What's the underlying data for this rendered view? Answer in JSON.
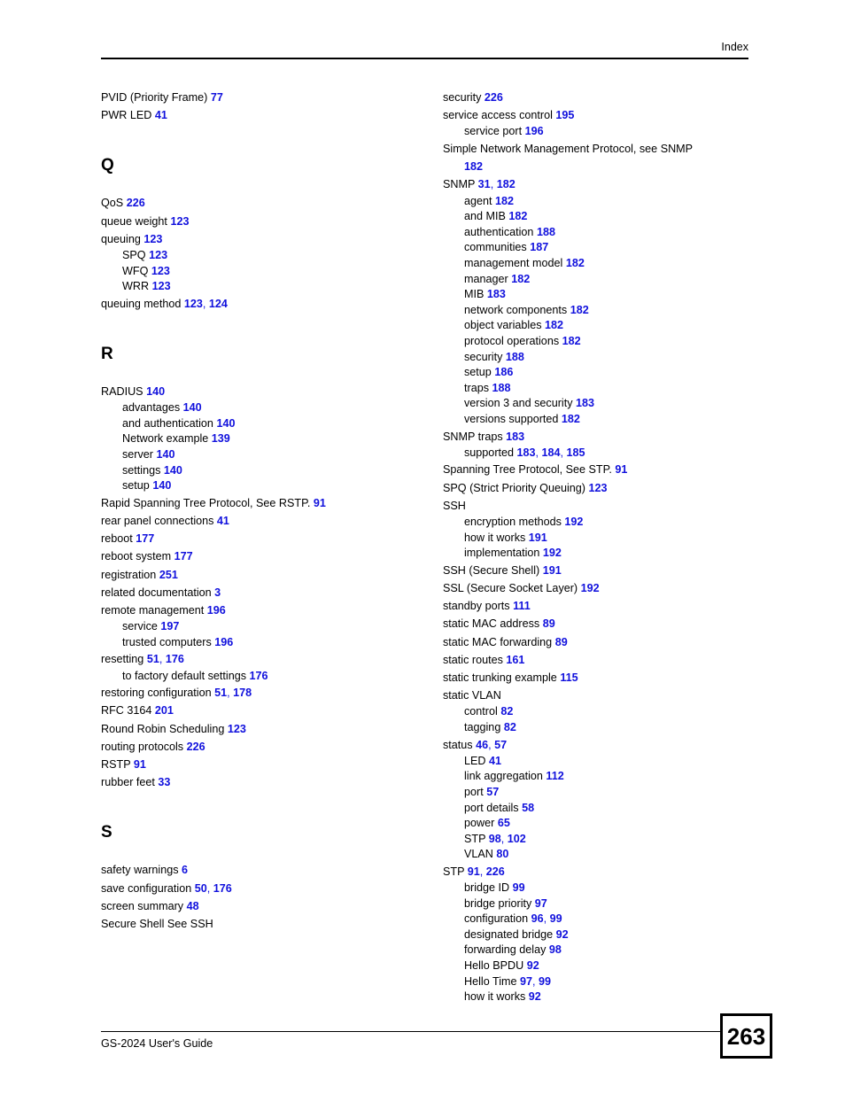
{
  "header": {
    "label": "Index"
  },
  "footer": {
    "guide_title": "GS-2024 User's Guide",
    "page_number": "263"
  },
  "colors": {
    "page_reference": "#1111dd",
    "text": "#000000",
    "background": "#ffffff"
  },
  "columns": [
    {
      "name": "left",
      "blocks": [
        {
          "type": "entries",
          "entries": [
            {
              "level": 0,
              "text": "PVID (Priority Frame)",
              "pages": [
                "77"
              ]
            },
            {
              "level": 0,
              "text": "PWR LED",
              "pages": [
                "41"
              ]
            }
          ]
        },
        {
          "type": "letter",
          "letter": "Q"
        },
        {
          "type": "entries",
          "entries": [
            {
              "level": 0,
              "text": "QoS",
              "pages": [
                "226"
              ]
            },
            {
              "level": 0,
              "text": "queue weight",
              "pages": [
                "123"
              ]
            },
            {
              "level": 0,
              "text": "queuing",
              "pages": [
                "123"
              ]
            },
            {
              "level": 1,
              "text": "SPQ",
              "pages": [
                "123"
              ]
            },
            {
              "level": 1,
              "text": "WFQ",
              "pages": [
                "123"
              ]
            },
            {
              "level": 1,
              "text": "WRR",
              "pages": [
                "123"
              ]
            },
            {
              "level": 0,
              "text": "queuing method",
              "pages": [
                "123",
                "124"
              ]
            }
          ]
        },
        {
          "type": "letter",
          "letter": "R"
        },
        {
          "type": "entries",
          "entries": [
            {
              "level": 0,
              "text": "RADIUS",
              "pages": [
                "140"
              ]
            },
            {
              "level": 1,
              "text": "advantages",
              "pages": [
                "140"
              ]
            },
            {
              "level": 1,
              "text": "and authentication",
              "pages": [
                "140"
              ]
            },
            {
              "level": 1,
              "text": "Network example",
              "pages": [
                "139"
              ]
            },
            {
              "level": 1,
              "text": "server",
              "pages": [
                "140"
              ]
            },
            {
              "level": 1,
              "text": "settings",
              "pages": [
                "140"
              ]
            },
            {
              "level": 1,
              "text": "setup",
              "pages": [
                "140"
              ]
            },
            {
              "level": 0,
              "text": "Rapid Spanning Tree Protocol, See RSTP.",
              "pages": [
                "91"
              ]
            },
            {
              "level": 0,
              "text": "rear panel connections",
              "pages": [
                "41"
              ]
            },
            {
              "level": 0,
              "text": "reboot",
              "pages": [
                "177"
              ]
            },
            {
              "level": 0,
              "text": "reboot system",
              "pages": [
                "177"
              ]
            },
            {
              "level": 0,
              "text": "registration",
              "pages": [
                "251"
              ]
            },
            {
              "level": 0,
              "text": "related documentation",
              "pages": [
                "3"
              ]
            },
            {
              "level": 0,
              "text": "remote management",
              "pages": [
                "196"
              ]
            },
            {
              "level": 1,
              "text": "service",
              "pages": [
                "197"
              ]
            },
            {
              "level": 1,
              "text": "trusted computers",
              "pages": [
                "196"
              ]
            },
            {
              "level": 0,
              "text": "resetting",
              "pages": [
                "51",
                "176"
              ]
            },
            {
              "level": 1,
              "text": "to factory default settings",
              "pages": [
                "176"
              ]
            },
            {
              "level": 0,
              "text": "restoring configuration",
              "pages": [
                "51",
                "178"
              ]
            },
            {
              "level": 0,
              "text": "RFC 3164",
              "pages": [
                "201"
              ]
            },
            {
              "level": 0,
              "text": "Round Robin Scheduling",
              "pages": [
                "123"
              ]
            },
            {
              "level": 0,
              "text": "routing protocols",
              "pages": [
                "226"
              ]
            },
            {
              "level": 0,
              "text": "RSTP",
              "pages": [
                "91"
              ]
            },
            {
              "level": 0,
              "text": "rubber feet",
              "pages": [
                "33"
              ]
            }
          ]
        },
        {
          "type": "letter",
          "letter": "S"
        },
        {
          "type": "entries",
          "entries": [
            {
              "level": 0,
              "text": "safety warnings",
              "pages": [
                "6"
              ]
            },
            {
              "level": 0,
              "text": "save configuration",
              "pages": [
                "50",
                "176"
              ]
            },
            {
              "level": 0,
              "text": "screen summary",
              "pages": [
                "48"
              ]
            },
            {
              "level": 0,
              "text": "Secure Shell See SSH",
              "pages": []
            }
          ]
        }
      ]
    },
    {
      "name": "right",
      "blocks": [
        {
          "type": "entries",
          "entries": [
            {
              "level": 0,
              "text": "security",
              "pages": [
                "226"
              ]
            },
            {
              "level": 0,
              "text": "service access control",
              "pages": [
                "195"
              ]
            },
            {
              "level": 1,
              "text": "service port",
              "pages": [
                "196"
              ]
            },
            {
              "level": 0,
              "text": "Simple Network Management Protocol, see SNMP",
              "pages": [
                "182"
              ],
              "wrapped": true
            },
            {
              "level": 0,
              "text": "SNMP",
              "pages": [
                "31",
                "182"
              ]
            },
            {
              "level": 1,
              "text": "agent",
              "pages": [
                "182"
              ]
            },
            {
              "level": 1,
              "text": "and MIB",
              "pages": [
                "182"
              ]
            },
            {
              "level": 1,
              "text": "authentication",
              "pages": [
                "188"
              ]
            },
            {
              "level": 1,
              "text": "communities",
              "pages": [
                "187"
              ]
            },
            {
              "level": 1,
              "text": "management model",
              "pages": [
                "182"
              ]
            },
            {
              "level": 1,
              "text": "manager",
              "pages": [
                "182"
              ]
            },
            {
              "level": 1,
              "text": "MIB",
              "pages": [
                "183"
              ]
            },
            {
              "level": 1,
              "text": "network components",
              "pages": [
                "182"
              ]
            },
            {
              "level": 1,
              "text": "object variables",
              "pages": [
                "182"
              ]
            },
            {
              "level": 1,
              "text": "protocol operations",
              "pages": [
                "182"
              ]
            },
            {
              "level": 1,
              "text": "security",
              "pages": [
                "188"
              ]
            },
            {
              "level": 1,
              "text": "setup",
              "pages": [
                "186"
              ]
            },
            {
              "level": 1,
              "text": "traps",
              "pages": [
                "188"
              ]
            },
            {
              "level": 1,
              "text": "version 3 and security",
              "pages": [
                "183"
              ]
            },
            {
              "level": 1,
              "text": "versions supported",
              "pages": [
                "182"
              ]
            },
            {
              "level": 0,
              "text": "SNMP traps",
              "pages": [
                "183"
              ]
            },
            {
              "level": 1,
              "text": "supported",
              "pages": [
                "183",
                "184",
                "185"
              ]
            },
            {
              "level": 0,
              "text": "Spanning Tree Protocol, See STP.",
              "pages": [
                "91"
              ]
            },
            {
              "level": 0,
              "text": "SPQ (Strict Priority Queuing)",
              "pages": [
                "123"
              ]
            },
            {
              "level": 0,
              "text": "SSH",
              "pages": []
            },
            {
              "level": 1,
              "text": "encryption methods",
              "pages": [
                "192"
              ]
            },
            {
              "level": 1,
              "text": "how it works",
              "pages": [
                "191"
              ]
            },
            {
              "level": 1,
              "text": "implementation",
              "pages": [
                "192"
              ]
            },
            {
              "level": 0,
              "text": "SSH (Secure Shell)",
              "pages": [
                "191"
              ]
            },
            {
              "level": 0,
              "text": "SSL (Secure Socket Layer)",
              "pages": [
                "192"
              ]
            },
            {
              "level": 0,
              "text": "standby ports",
              "pages": [
                "111"
              ]
            },
            {
              "level": 0,
              "text": "static MAC address",
              "pages": [
                "89"
              ]
            },
            {
              "level": 0,
              "text": "static MAC forwarding",
              "pages": [
                "89"
              ]
            },
            {
              "level": 0,
              "text": "static routes",
              "pages": [
                "161"
              ]
            },
            {
              "level": 0,
              "text": "static trunking example",
              "pages": [
                "115"
              ]
            },
            {
              "level": 0,
              "text": "static VLAN",
              "pages": []
            },
            {
              "level": 1,
              "text": "control",
              "pages": [
                "82"
              ]
            },
            {
              "level": 1,
              "text": "tagging",
              "pages": [
                "82"
              ]
            },
            {
              "level": 0,
              "text": "status",
              "pages": [
                "46",
                "57"
              ]
            },
            {
              "level": 1,
              "text": "LED",
              "pages": [
                "41"
              ]
            },
            {
              "level": 1,
              "text": "link aggregation",
              "pages": [
                "112"
              ]
            },
            {
              "level": 1,
              "text": "port",
              "pages": [
                "57"
              ]
            },
            {
              "level": 1,
              "text": "port details",
              "pages": [
                "58"
              ]
            },
            {
              "level": 1,
              "text": "power",
              "pages": [
                "65"
              ]
            },
            {
              "level": 1,
              "text": "STP",
              "pages": [
                "98",
                "102"
              ]
            },
            {
              "level": 1,
              "text": "VLAN",
              "pages": [
                "80"
              ]
            },
            {
              "level": 0,
              "text": "STP",
              "pages": [
                "91",
                "226"
              ]
            },
            {
              "level": 1,
              "text": "bridge ID",
              "pages": [
                "99"
              ]
            },
            {
              "level": 1,
              "text": "bridge priority",
              "pages": [
                "97"
              ]
            },
            {
              "level": 1,
              "text": "configuration",
              "pages": [
                "96",
                "99"
              ]
            },
            {
              "level": 1,
              "text": "designated bridge",
              "pages": [
                "92"
              ]
            },
            {
              "level": 1,
              "text": "forwarding delay",
              "pages": [
                "98"
              ]
            },
            {
              "level": 1,
              "text": "Hello BPDU",
              "pages": [
                "92"
              ]
            },
            {
              "level": 1,
              "text": "Hello Time",
              "pages": [
                "97",
                "99"
              ]
            },
            {
              "level": 1,
              "text": "how it works",
              "pages": [
                "92"
              ]
            }
          ]
        }
      ]
    }
  ]
}
